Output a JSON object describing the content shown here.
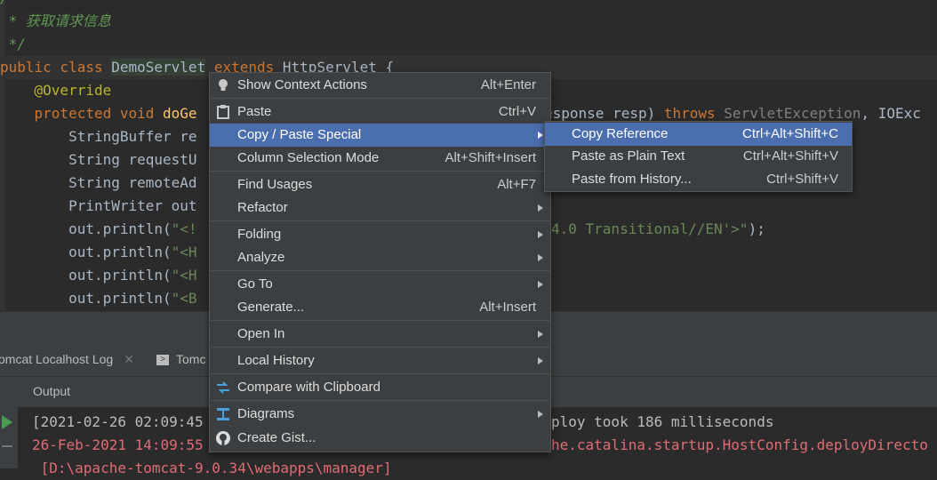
{
  "editor": {
    "lines": [
      {
        "text": "/**"
      },
      {
        "text": " * 获取请求信息"
      },
      {
        "text": " */"
      },
      {
        "kw1": "public class ",
        "cls": "DemoServlet",
        "kw2": " extends ",
        "rest": "HttpServlet {"
      },
      {
        "text": "    @Override"
      },
      {
        "kw": "    protected void ",
        "fn": "doGe"
      },
      {
        "text": "        StringBuffer re"
      },
      {
        "text": "        String requestU"
      },
      {
        "text": "        String remoteAd"
      },
      {
        "text": "        PrintWriter out"
      },
      {
        "pre": "        out.println(",
        "str": "\"<!"
      },
      {
        "pre": "        out.println(",
        "str": "\"<H"
      },
      {
        "pre": "        out.println(",
        "str": "\"<H"
      },
      {
        "pre": "        out.println(",
        "str": "\"<B"
      }
    ],
    "behind": {
      "l1_a": "esponse resp) ",
      "l1_kw": "throws ",
      "l1_ex": "ServletException",
      "l1_rest": ", IOExc",
      "l2_str": "4.0 Transitional//EN'>\"",
      "l2_rest": ");"
    }
  },
  "toolwindow": {
    "tabs": [
      "omcat Localhost Log",
      "Tomc"
    ],
    "output_label": "Output",
    "log": [
      {
        "a": "[2021-02-26 02:09:45",
        "b": "ploy took 186 milliseconds"
      },
      {
        "a": "26-Feb-2021 14:09:55",
        "b": "he.catalina.startup.HostConfig.deployDirecto"
      },
      {
        "a": " [D:\\apache-tomcat-9.0.34\\webapps\\manager]"
      }
    ],
    "colors": {
      "info": "#bbbbbb",
      "error": "#e06c75"
    }
  },
  "context_menu": {
    "items": [
      {
        "label": "Show Context Actions",
        "shortcut": "Alt+Enter",
        "icon": "lightbulb-icon"
      },
      {
        "label": "Paste",
        "shortcut": "Ctrl+V",
        "icon": "clipboard-icon"
      },
      {
        "label": "Copy / Paste Special",
        "shortcut": "",
        "submenu": true
      },
      {
        "label": "Column Selection Mode",
        "shortcut": "Alt+Shift+Insert"
      },
      {
        "label": "Find Usages",
        "shortcut": "Alt+F7"
      },
      {
        "label": "Refactor",
        "shortcut": "",
        "submenu": true
      },
      {
        "label": "Folding",
        "shortcut": "",
        "submenu": true
      },
      {
        "label": "Analyze",
        "shortcut": "",
        "submenu": true
      },
      {
        "label": "Go To",
        "shortcut": "",
        "submenu": true
      },
      {
        "label": "Generate...",
        "shortcut": "Alt+Insert"
      },
      {
        "label": "Open In",
        "shortcut": "",
        "submenu": true
      },
      {
        "label": "Local History",
        "shortcut": "",
        "submenu": true
      },
      {
        "label": "Compare with Clipboard",
        "shortcut": "",
        "icon": "compare-icon"
      },
      {
        "label": "Diagrams",
        "shortcut": "",
        "submenu": true,
        "icon": "diagram-icon"
      },
      {
        "label": "Create Gist...",
        "shortcut": "",
        "icon": "github-icon"
      }
    ]
  },
  "submenu": {
    "items": [
      {
        "label": "Copy Reference",
        "shortcut": "Ctrl+Alt+Shift+C"
      },
      {
        "label": "Paste as Plain Text",
        "shortcut": "Ctrl+Alt+Shift+V"
      },
      {
        "label": "Paste from History...",
        "shortcut": "Ctrl+Shift+V"
      }
    ]
  },
  "colors": {
    "selection": "#4b6eaf",
    "menu_bg": "#3c3f41",
    "editor_bg": "#2b2b2b"
  }
}
